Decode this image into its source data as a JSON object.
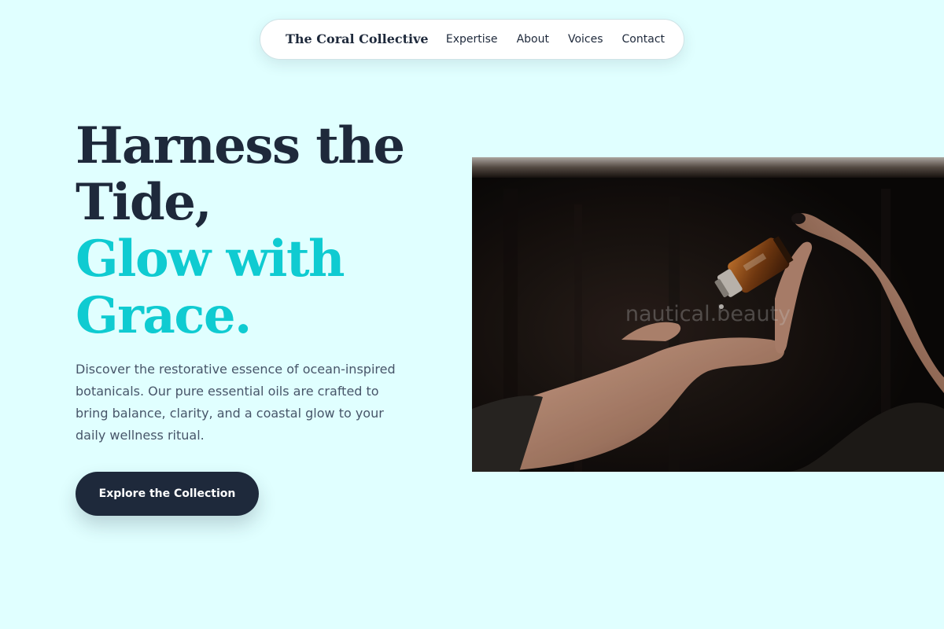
{
  "nav": {
    "brand": "The Coral Collective",
    "links": [
      "Expertise",
      "About",
      "Voices",
      "Contact"
    ]
  },
  "hero": {
    "title_dark": [
      "Harness the",
      "Tide,"
    ],
    "title_accent": [
      "Glow with",
      "Grace."
    ],
    "description": "Discover the restorative essence of ocean-inspired botanicals. Our pure essential oils are crafted to bring balance, clarity, and a coastal glow to your daily wellness ritual.",
    "cta_label": "Explore the Collection",
    "image_watermark": "nautical.beauty"
  },
  "colors": {
    "background": "#e0ffff",
    "dark": "#1e293b",
    "accent": "#0fcbd1",
    "body_text": "#475569"
  }
}
